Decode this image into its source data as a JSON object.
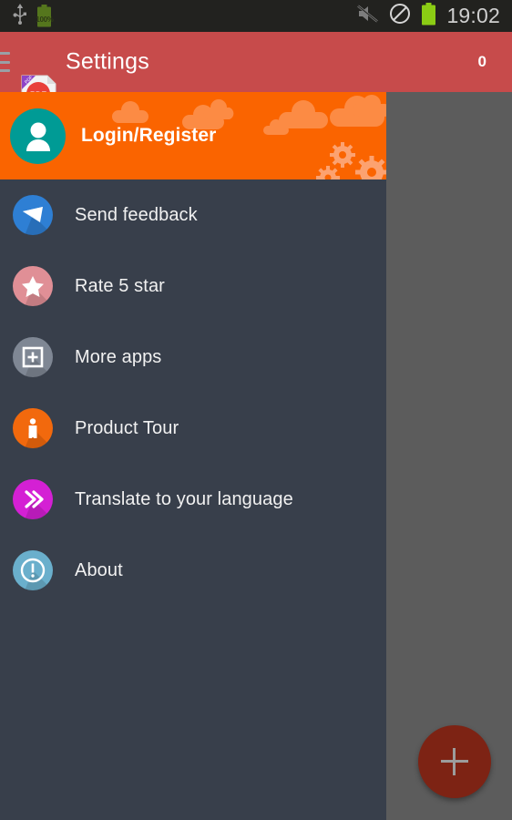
{
  "status_bar": {
    "time": "19:02",
    "battery_percent": "100%",
    "icons": [
      {
        "name": "usb-icon",
        "label": "USB connected"
      },
      {
        "name": "battery-charging-icon",
        "label": "Battery 100%"
      },
      {
        "name": "mute-icon",
        "label": "Sound muted"
      },
      {
        "name": "do-not-disturb-icon",
        "label": "Do not disturb"
      },
      {
        "name": "battery-icon",
        "label": "Battery full"
      }
    ],
    "background_color": "#22221f",
    "text_color": "#cfcfcf"
  },
  "app_bar": {
    "title": "Settings",
    "badge": "0",
    "background_color": "#c74b4b",
    "menu_icon": "hamburger-menu-icon",
    "app_icon": "pdf-document-icon",
    "app_icon_text": "PDF"
  },
  "drawer": {
    "background_color": "#383f4b",
    "header": {
      "label": "Login/Register",
      "background_color": "#fa6400",
      "avatar_color": "#009b95",
      "avatar_icon": "person-avatar-icon",
      "decoration": "clouds-and-gears"
    },
    "items": [
      {
        "label": "Send feedback",
        "icon": "envelope-icon",
        "color": "#2e7fd4"
      },
      {
        "label": "Rate 5 star",
        "icon": "star-icon",
        "color": "#e08f96"
      },
      {
        "label": "More apps",
        "icon": "add-box-icon",
        "color": "#7f8794"
      },
      {
        "label": "Product Tour",
        "icon": "person-standing-icon",
        "color": "#f2690d"
      },
      {
        "label": "Translate to your language",
        "icon": "double-chevron-icon",
        "color": "#d420d4"
      },
      {
        "label": "About",
        "icon": "info-exclamation-icon",
        "color": "#6aafcc"
      }
    ]
  },
  "scrim": {
    "color": "#5c5c5c"
  },
  "fab": {
    "icon": "plus-icon",
    "color": "#7d2314",
    "icon_color": "#9c9c9c"
  }
}
